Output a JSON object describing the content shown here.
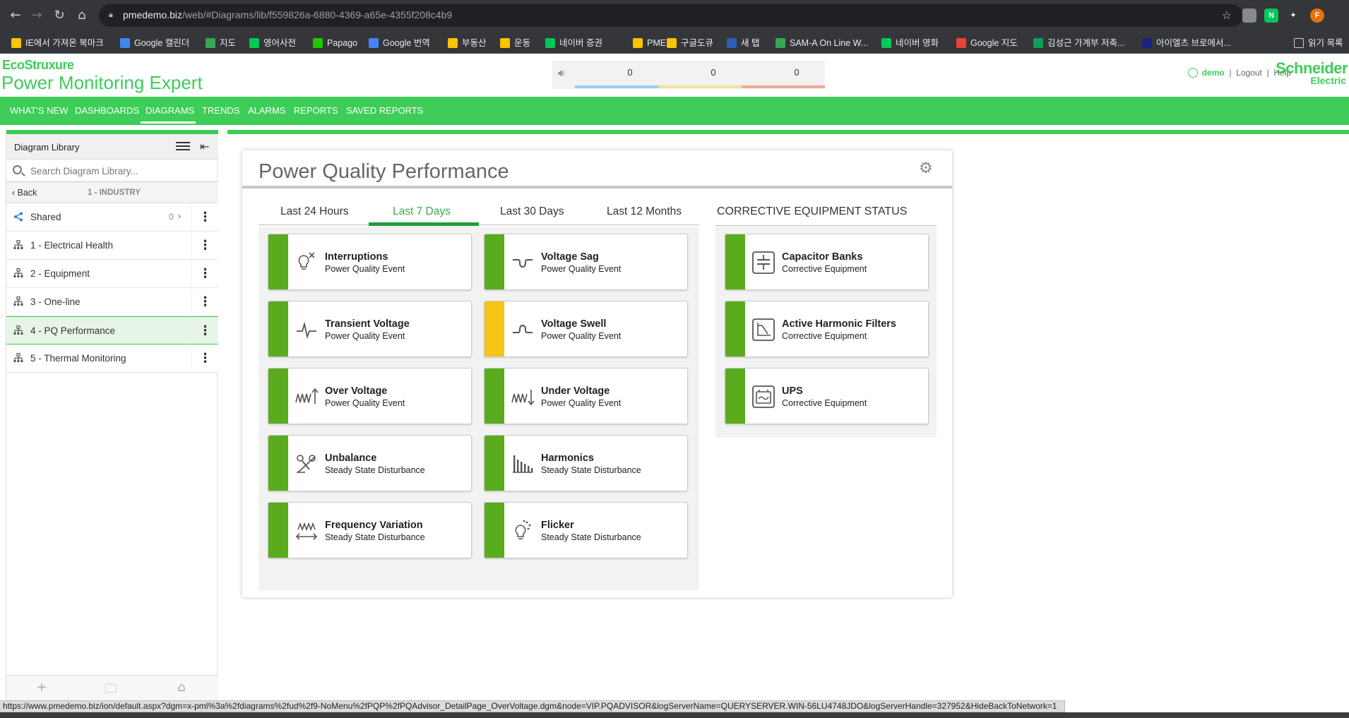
{
  "browser": {
    "url_host": "pmedemo.biz",
    "url_path": "/web/#Diagrams/lib/f559826a-6880-4369-a65e-4355f208c4b9",
    "extensions": [
      {
        "name": "ext-grey",
        "color": "#8a8a8a",
        "glyph": ""
      },
      {
        "name": "ext-naver",
        "color": "#03c75a",
        "glyph": "N"
      },
      {
        "name": "ext-puzzle",
        "color": "#35363a",
        "glyph": "✦"
      },
      {
        "name": "ext-profile",
        "color": "#e8710a",
        "glyph": "F"
      }
    ],
    "bookmarks": [
      {
        "label": "IE에서 가져온 북마크",
        "color": "#f9c400"
      },
      {
        "label": "Google 캘린더",
        "color": "#4285f4"
      },
      {
        "label": "지도",
        "color": "#34a853"
      },
      {
        "label": "영어사전",
        "color": "#03c75a"
      },
      {
        "label": "Papago",
        "color": "#1ec800"
      },
      {
        "label": "Google 번역",
        "color": "#4285f4"
      },
      {
        "label": "부동산",
        "color": "#f9c400"
      },
      {
        "label": "운동",
        "color": "#f9c400"
      },
      {
        "label": "네이버 증권",
        "color": "#03c75a"
      },
      {
        "label": "PME",
        "color": "#f9c400"
      },
      {
        "label": "구글도큐",
        "color": "#f9c400"
      },
      {
        "label": "새 탭",
        "color": "#2f5cb8"
      },
      {
        "label": "SAM-A On Line W...",
        "color": "#34a853"
      },
      {
        "label": "네이버 영화",
        "color": "#03c75a"
      },
      {
        "label": "Google 지도",
        "color": "#ea4335"
      },
      {
        "label": "김성근 가계부 저축...",
        "color": "#0f9d58"
      },
      {
        "label": "아이엘츠 브로에서...",
        "color": "#1a237e"
      }
    ],
    "reading_list": "읽기 목록",
    "status_url": "https://www.pmedemo.biz/ion/default.aspx?dgm=x-pml%3a%2fdiagrams%2fud%2f9-NoMenu%2fPQP%2fPQAdvisor_DetailPage_OverVoltage.dgm&node=VIP.PQADVISOR&logServerName=QUERYSERVER.WIN-56LU4748JDO&logServerHandle=327952&HideBackToNetwork=1"
  },
  "header": {
    "brand_eco": "EcoStruxure",
    "product": "Power Monitoring Expert",
    "alarm_counts": [
      "0",
      "0",
      "0"
    ],
    "alarm_colors": [
      "#9ecbef",
      "#f3e19a",
      "#f2a898"
    ],
    "user": "demo",
    "logout": "Logout",
    "help": "Help",
    "logo_line1": "Schneider",
    "logo_line2": "Electric"
  },
  "nav": {
    "items": [
      "WHAT'S NEW",
      "DASHBOARDS",
      "DIAGRAMS",
      "TRENDS",
      "ALARMS",
      "REPORTS",
      "SAVED REPORTS"
    ],
    "active": "DIAGRAMS"
  },
  "sidebar": {
    "title": "Diagram Library",
    "search_placeholder": "Search Diagram Library...",
    "back": "Back",
    "crumb": "1 - INDUSTRY",
    "shared": {
      "label": "Shared",
      "count": "0"
    },
    "items": [
      {
        "label": "1 - Electrical Health"
      },
      {
        "label": "2 - Equipment"
      },
      {
        "label": "3 - One-line"
      },
      {
        "label": "4 - PQ Performance"
      },
      {
        "label": "5 - Thermal Monitoring"
      }
    ],
    "active_index": 3
  },
  "panel": {
    "title": "Power Quality Performance",
    "tabs": [
      "Last 24 Hours",
      "Last 7 Days",
      "Last 30 Days",
      "Last 12 Months"
    ],
    "active_tab": 1,
    "pq_tiles": [
      {
        "name": "Interruptions",
        "sub": "Power Quality Event",
        "status": "#5aab1e",
        "icon": "lightbulb-off-icon"
      },
      {
        "name": "Voltage Sag",
        "sub": "Power Quality Event",
        "status": "#5aab1e",
        "icon": "voltage-sag-icon"
      },
      {
        "name": "Transient Voltage",
        "sub": "Power Quality Event",
        "status": "#5aab1e",
        "icon": "transient-icon"
      },
      {
        "name": "Voltage Swell",
        "sub": "Power Quality Event",
        "status": "#f5c518",
        "icon": "voltage-swell-icon"
      },
      {
        "name": "Over Voltage",
        "sub": "Power Quality Event",
        "status": "#5aab1e",
        "icon": "over-voltage-icon"
      },
      {
        "name": "Under Voltage",
        "sub": "Power Quality Event",
        "status": "#5aab1e",
        "icon": "under-voltage-icon"
      },
      {
        "name": "Unbalance",
        "sub": "Steady State Disturbance",
        "status": "#5aab1e",
        "icon": "unbalance-icon"
      },
      {
        "name": "Harmonics",
        "sub": "Steady State Disturbance",
        "status": "#5aab1e",
        "icon": "harmonics-icon"
      },
      {
        "name": "Frequency Variation",
        "sub": "Steady State Disturbance",
        "status": "#5aab1e",
        "icon": "frequency-icon"
      },
      {
        "name": "Flicker",
        "sub": "Steady State Disturbance",
        "status": "#5aab1e",
        "icon": "flicker-icon"
      }
    ],
    "ce_title": "CORRECTIVE EQUIPMENT STATUS",
    "ce_tiles": [
      {
        "name": "Capacitor Banks",
        "sub": "Corrective Equipment",
        "status": "#5aab1e",
        "icon": "capacitor-icon"
      },
      {
        "name": "Active Harmonic Filters",
        "sub": "Corrective Equipment",
        "status": "#5aab1e",
        "icon": "harmonic-filter-icon"
      },
      {
        "name": "UPS",
        "sub": "Corrective Equipment",
        "status": "#5aab1e",
        "icon": "ups-icon"
      }
    ]
  }
}
